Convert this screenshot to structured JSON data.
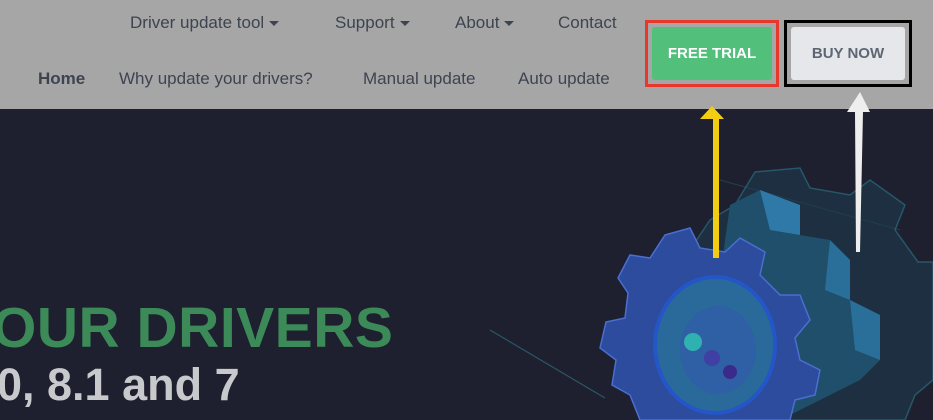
{
  "nav": {
    "top": [
      {
        "label": "Driver update tool",
        "dropdown": true
      },
      {
        "label": "Support",
        "dropdown": true
      },
      {
        "label": "About",
        "dropdown": true
      },
      {
        "label": "Contact",
        "dropdown": false
      }
    ],
    "bottom": [
      {
        "label": "Home",
        "active": true
      },
      {
        "label": "Why update your drivers?"
      },
      {
        "label": "Manual update"
      },
      {
        "label": "Auto update"
      }
    ]
  },
  "buttons": {
    "free_trial": {
      "label": "FREE TRIAL",
      "color": "#52c07a",
      "highlight": "#e8382c"
    },
    "buy_now": {
      "label": "BUY NOW",
      "color": "#e5e7ea",
      "highlight": "#000000"
    }
  },
  "hero": {
    "line1": "OUR DRIVERS",
    "line2": "0, 8.1 and 7"
  },
  "annotations": {
    "arrow_free_trial_color": "#f2cd14",
    "arrow_buy_now_color": "#eeeeee"
  },
  "icons": {
    "hero_graphic": "gear-illustration",
    "caret": "chevron-down-icon"
  }
}
